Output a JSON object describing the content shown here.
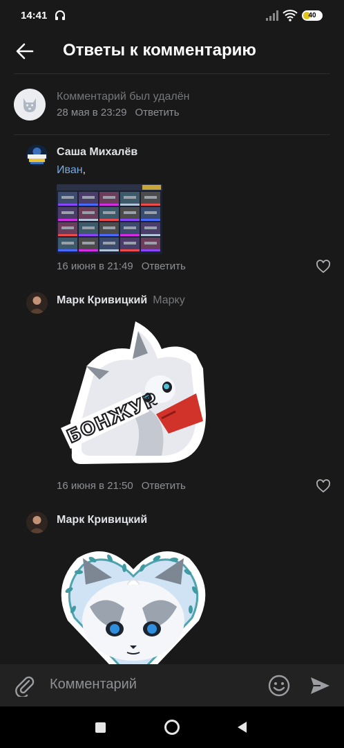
{
  "status_bar": {
    "time": "14:41",
    "battery_label": "40",
    "battery_level": 0.4,
    "icons": [
      "headphones-icon",
      "signal-icon",
      "wifi-icon",
      "battery-icon"
    ]
  },
  "header": {
    "title": "Ответы к комментарию",
    "back_icon": "arrow-left-icon"
  },
  "root_comment": {
    "text": "Комментарий был удалён",
    "date": "28 мая в 23:29",
    "reply_label": "Ответить",
    "avatar_icon": "deleted-user-dog-icon"
  },
  "replies": [
    {
      "author": "Саша Михалёв",
      "mention": "Иван",
      "text_suffix": ",",
      "attachment": "photo (weapon inventory screenshot)",
      "date": "16 июня в 21:49",
      "reply_label": "Ответить",
      "like_icon": "heart-icon"
    },
    {
      "author": "Марк Кривицкий",
      "reply_to": "Марку",
      "sticker_text": "БОНЖУР",
      "date": "16 июня в 21:50",
      "reply_label": "Ответить",
      "like_icon": "heart-icon"
    },
    {
      "author": "Марк Кривицкий",
      "sticker": "fox in heart wreath"
    }
  ],
  "composer": {
    "placeholder": "Комментарий",
    "icons": [
      "paperclip-icon",
      "emoji-icon",
      "send-icon"
    ]
  },
  "colors": {
    "background": "#19191a",
    "text_primary": "#e1e3e6",
    "text_secondary": "#8e9094",
    "link": "#71aaeb",
    "battery": "#e0c21c"
  }
}
